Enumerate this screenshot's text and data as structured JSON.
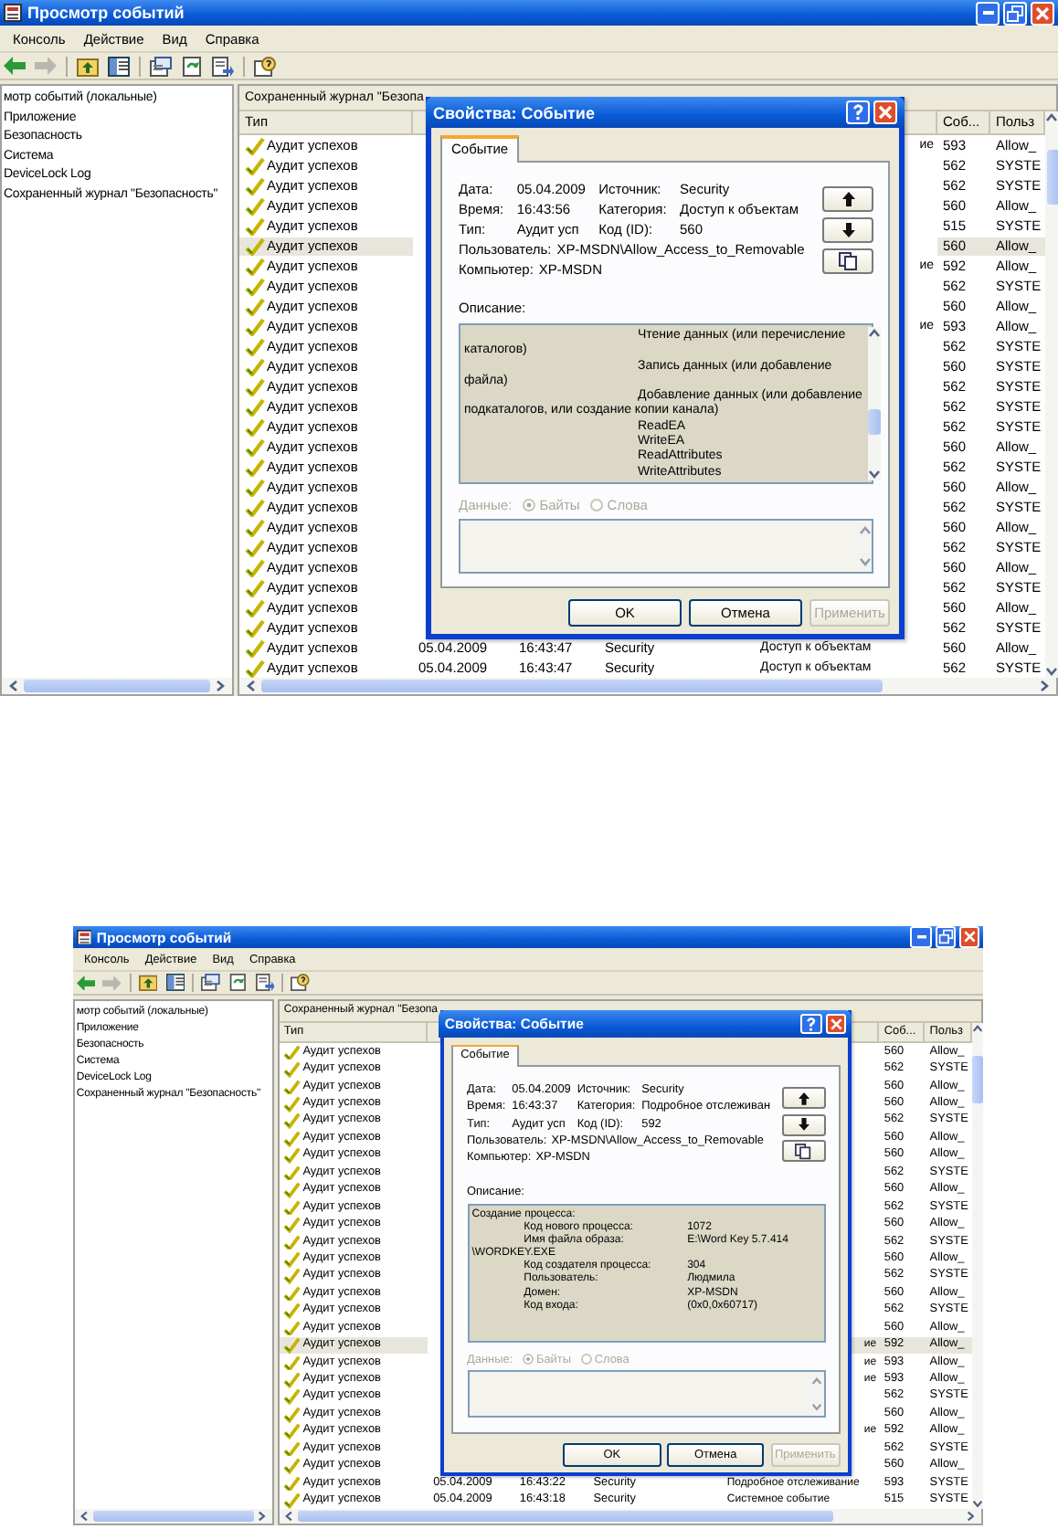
{
  "screens": [
    {
      "window": {
        "title": "Просмотр событий"
      },
      "menu": [
        "Консоль",
        "Действие",
        "Вид",
        "Справка"
      ],
      "tree": {
        "text": "мотр событий (локальные)",
        "children": [
          {
            "text": "Приложение"
          },
          {
            "text": "Безопасность"
          },
          {
            "text": "Система"
          },
          {
            "text": "DeviceLock Log"
          },
          {
            "text": "Сохраненный журнал \"Безопасность\""
          }
        ]
      },
      "list": {
        "title": "Сохраненный журнал \"Безопа",
        "columns": {
          "type": "Тип",
          "event": "Соб...",
          "user": "Польз"
        },
        "rows": [
          {
            "type": "Аудит успехов",
            "category_tail": "ие",
            "event": "593",
            "user": "Allow_",
            "selected": false
          },
          {
            "type": "Аудит успехов",
            "event": "562",
            "user": "SYSTE",
            "selected": false
          },
          {
            "type": "Аудит успехов",
            "event": "562",
            "user": "SYSTE",
            "selected": false
          },
          {
            "type": "Аудит успехов",
            "event": "560",
            "user": "Allow_",
            "selected": false
          },
          {
            "type": "Аудит успехов",
            "event": "515",
            "user": "SYSTE",
            "selected": false
          },
          {
            "type": "Аудит успехов",
            "event": "560",
            "user": "Allow_",
            "selected": true
          },
          {
            "type": "Аудит успехов",
            "category_tail": "ие",
            "event": "592",
            "user": "Allow_",
            "selected": false
          },
          {
            "type": "Аудит успехов",
            "event": "562",
            "user": "SYSTE",
            "selected": false
          },
          {
            "type": "Аудит успехов",
            "event": "560",
            "user": "Allow_",
            "selected": false
          },
          {
            "type": "Аудит успехов",
            "category_tail": "ие",
            "event": "593",
            "user": "Allow_",
            "selected": false
          },
          {
            "type": "Аудит успехов",
            "event": "562",
            "user": "SYSTE",
            "selected": false
          },
          {
            "type": "Аудит успехов",
            "event": "560",
            "user": "SYSTE",
            "selected": false
          },
          {
            "type": "Аудит успехов",
            "event": "562",
            "user": "SYSTE",
            "selected": false
          },
          {
            "type": "Аудит успехов",
            "event": "562",
            "user": "SYSTE",
            "selected": false
          },
          {
            "type": "Аудит успехов",
            "event": "562",
            "user": "SYSTE",
            "selected": false
          },
          {
            "type": "Аудит успехов",
            "event": "560",
            "user": "Allow_",
            "selected": false
          },
          {
            "type": "Аудит успехов",
            "event": "562",
            "user": "SYSTE",
            "selected": false
          },
          {
            "type": "Аудит успехов",
            "event": "560",
            "user": "Allow_",
            "selected": false
          },
          {
            "type": "Аудит успехов",
            "event": "562",
            "user": "SYSTE",
            "selected": false
          },
          {
            "type": "Аудит успехов",
            "event": "560",
            "user": "Allow_",
            "selected": false
          },
          {
            "type": "Аудит успехов",
            "event": "562",
            "user": "SYSTE",
            "selected": false
          },
          {
            "type": "Аудит успехов",
            "event": "560",
            "user": "Allow_",
            "selected": false
          },
          {
            "type": "Аудит успехов",
            "event": "562",
            "user": "SYSTE",
            "selected": false
          },
          {
            "type": "Аудит успехов",
            "event": "560",
            "user": "Allow_",
            "selected": false
          },
          {
            "type": "Аудит успехов",
            "event": "562",
            "user": "SYSTE",
            "selected": false
          },
          {
            "type": "Аудит успехов",
            "date": "05.04.2009",
            "time": "16:43:47",
            "source": "Security",
            "category": "Доступ к объектам",
            "event": "560",
            "user": "Allow_",
            "selected": false
          },
          {
            "type": "Аудит успехов",
            "date": "05.04.2009",
            "time": "16:43:47",
            "source": "Security",
            "category": "Доступ к объектам",
            "event": "562",
            "user": "SYSTE",
            "selected": false
          }
        ]
      },
      "dialog": {
        "title": "Свойства: Событие",
        "tabs": [
          {
            "label": "Событие",
            "selected": true
          }
        ],
        "fields": [
          {
            "kind": "half",
            "label": "Дата:",
            "value": "05.04.2009"
          },
          {
            "kind": "half",
            "label": "Источник:",
            "value": "Security"
          },
          {
            "kind": "half",
            "label": "Время:",
            "value": "16:43:56"
          },
          {
            "kind": "half",
            "label": "Категория:",
            "value": "Доступ к объектам"
          },
          {
            "kind": "half",
            "label": "Тип:",
            "value": "Аудит усп"
          },
          {
            "kind": "half",
            "label": "Код (ID):",
            "value": "560"
          },
          {
            "kind": "full",
            "label": "Пользователь:",
            "value": "XP-MSDN\\Allow_Access_to_Removable"
          },
          {
            "kind": "full",
            "label": "Компьютер:",
            "value": "XP-MSDN"
          }
        ],
        "description_label": "Описание:",
        "description_scrollbar": true,
        "description": [
          {
            "kind": "deep",
            "text": "Чтение данных (или перечисление"
          },
          {
            "kind": "flush",
            "text": "каталогов)"
          },
          {
            "kind": "deep",
            "text": "Запись данных (или добавление"
          },
          {
            "kind": "flush",
            "text": "файла)"
          },
          {
            "kind": "deep",
            "text": "Добавление данных (или добавление"
          },
          {
            "kind": "flush",
            "text": "подкаталогов, или создание копии канала)"
          },
          {
            "kind": "deep",
            "text": "ReadEA"
          },
          {
            "kind": "deep",
            "text": "WriteEA"
          },
          {
            "kind": "deep",
            "text": "ReadAttributes"
          },
          {
            "kind": "deep",
            "text": "WriteAttributes"
          }
        ],
        "data": {
          "label": "Данные:",
          "disabled": true,
          "options": [
            {
              "label": "Байты",
              "selected": true
            },
            {
              "label": "Слова",
              "selected": false
            }
          ]
        },
        "buttons": [
          {
            "label": "OK",
            "disabled": false
          },
          {
            "label": "Отмена",
            "disabled": false
          },
          {
            "label": "Применить",
            "disabled": true
          }
        ]
      }
    },
    {
      "window": {
        "title": "Просмотр событий"
      },
      "menu": [
        "Консоль",
        "Действие",
        "Вид",
        "Справка"
      ],
      "tree": {
        "text": "мотр событий (локальные)",
        "children": [
          {
            "text": "Приложение"
          },
          {
            "text": "Безопасность"
          },
          {
            "text": "Система"
          },
          {
            "text": "DeviceLock Log"
          },
          {
            "text": "Сохраненный журнал \"Безопасность\""
          }
        ]
      },
      "list": {
        "title": "Сохраненный журнал \"Безопа",
        "columns": {
          "type": "Тип",
          "event": "Соб...",
          "user": "Польз"
        },
        "rows": [
          {
            "type": "Аудит успехов",
            "event": "560",
            "user": "Allow_",
            "selected": false
          },
          {
            "type": "Аудит успехов",
            "event": "562",
            "user": "SYSTE",
            "selected": false
          },
          {
            "type": "Аудит успехов",
            "event": "560",
            "user": "Allow_",
            "selected": false
          },
          {
            "type": "Аудит успехов",
            "event": "560",
            "user": "Allow_",
            "selected": false
          },
          {
            "type": "Аудит успехов",
            "event": "562",
            "user": "SYSTE",
            "selected": false
          },
          {
            "type": "Аудит успехов",
            "event": "560",
            "user": "Allow_",
            "selected": false
          },
          {
            "type": "Аудит успехов",
            "event": "560",
            "user": "Allow_",
            "selected": false
          },
          {
            "type": "Аудит успехов",
            "event": "562",
            "user": "SYSTE",
            "selected": false
          },
          {
            "type": "Аудит успехов",
            "event": "560",
            "user": "Allow_",
            "selected": false
          },
          {
            "type": "Аудит успехов",
            "event": "562",
            "user": "SYSTE",
            "selected": false
          },
          {
            "type": "Аудит успехов",
            "event": "560",
            "user": "Allow_",
            "selected": false
          },
          {
            "type": "Аудит успехов",
            "event": "562",
            "user": "SYSTE",
            "selected": false
          },
          {
            "type": "Аудит успехов",
            "event": "560",
            "user": "Allow_",
            "selected": false
          },
          {
            "type": "Аудит успехов",
            "event": "562",
            "user": "SYSTE",
            "selected": false
          },
          {
            "type": "Аудит успехов",
            "event": "560",
            "user": "Allow_",
            "selected": false
          },
          {
            "type": "Аудит успехов",
            "event": "562",
            "user": "SYSTE",
            "selected": false
          },
          {
            "type": "Аудит успехов",
            "event": "560",
            "user": "Allow_",
            "selected": false
          },
          {
            "type": "Аудит успехов",
            "category_tail": "ие",
            "event": "592",
            "user": "Allow_",
            "selected": true
          },
          {
            "type": "Аудит успехов",
            "category_tail": "ие",
            "event": "593",
            "user": "Allow_",
            "selected": false
          },
          {
            "type": "Аудит успехов",
            "category_tail": "ие",
            "event": "593",
            "user": "Allow_",
            "selected": false
          },
          {
            "type": "Аудит успехов",
            "event": "562",
            "user": "SYSTE",
            "selected": false
          },
          {
            "type": "Аудит успехов",
            "event": "560",
            "user": "Allow_",
            "selected": false
          },
          {
            "type": "Аудит успехов",
            "category_tail": "ие",
            "event": "592",
            "user": "Allow_",
            "selected": false
          },
          {
            "type": "Аудит успехов",
            "event": "562",
            "user": "SYSTE",
            "selected": false
          },
          {
            "type": "Аудит успехов",
            "event": "560",
            "user": "Allow_",
            "selected": false
          },
          {
            "type": "Аудит успехов",
            "date": "05.04.2009",
            "time": "16:43:22",
            "source": "Security",
            "category": "Подробное отслеживание",
            "event": "593",
            "user": "SYSTE",
            "selected": false
          },
          {
            "type": "Аудит успехов",
            "date": "05.04.2009",
            "time": "16:43:18",
            "source": "Security",
            "category": "Системное событие",
            "event": "515",
            "user": "SYSTE",
            "selected": false
          }
        ]
      },
      "dialog": {
        "title": "Свойства: Событие",
        "tabs": [
          {
            "label": "Событие",
            "selected": true
          }
        ],
        "fields": [
          {
            "kind": "half",
            "label": "Дата:",
            "value": "05.04.2009"
          },
          {
            "kind": "half",
            "label": "Источник:",
            "value": "Security"
          },
          {
            "kind": "half",
            "label": "Время:",
            "value": "16:43:37"
          },
          {
            "kind": "half",
            "label": "Категория:",
            "value": "Подробное отслеживан"
          },
          {
            "kind": "half",
            "label": "Тип:",
            "value": "Аудит усп"
          },
          {
            "kind": "half",
            "label": "Код (ID):",
            "value": "592"
          },
          {
            "kind": "full",
            "label": "Пользователь:",
            "value": "XP-MSDN\\Allow_Access_to_Removable"
          },
          {
            "kind": "full",
            "label": "Компьютер:",
            "value": "XP-MSDN"
          }
        ],
        "description_label": "Описание:",
        "description_scrollbar": false,
        "description": [
          {
            "kind": "flush",
            "text": "Создание процесса:"
          },
          {
            "kind": "pair",
            "text": "Код нового процесса:",
            "value": "1072"
          },
          {
            "kind": "pair",
            "text": "Имя файла образа:",
            "value": "E:\\Word Key 5.7.414"
          },
          {
            "kind": "flush",
            "text": "\\WORDKEY.EXE"
          },
          {
            "kind": "pair",
            "text": "Код создателя процесса:",
            "value": "304"
          },
          {
            "kind": "pair",
            "text": "Пользователь:",
            "value": "Людмила"
          },
          {
            "kind": "pair",
            "text": "Домен:",
            "value": "XP-MSDN"
          },
          {
            "kind": "pair",
            "text": "Код входа:",
            "value": "(0x0,0x60717)"
          }
        ],
        "data": {
          "label": "Данные:",
          "disabled": true,
          "options": [
            {
              "label": "Байты",
              "selected": true
            },
            {
              "label": "Слова",
              "selected": false
            }
          ]
        },
        "buttons": [
          {
            "label": "OK",
            "disabled": false
          },
          {
            "label": "Отмена",
            "disabled": false
          },
          {
            "label": "Применить",
            "disabled": true
          }
        ]
      }
    }
  ]
}
